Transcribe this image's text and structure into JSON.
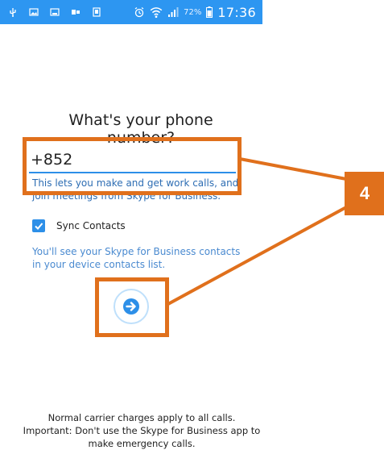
{
  "status_bar": {
    "battery_text": "72%",
    "time": "17:36",
    "left_icons": [
      "usb-icon",
      "image-icon",
      "screen-icon",
      "notification-icon",
      "device-icon"
    ],
    "right_icons": [
      "alarm-icon",
      "wifi-icon",
      "signal-icon",
      "battery-icon"
    ],
    "color": "#2d96f1"
  },
  "screen": {
    "title": "What's your phone number?",
    "phone_input": {
      "value": "+852",
      "placeholder": ""
    },
    "helper_text": "This lets you make and get work calls, and join meetings from Skype for Business.",
    "sync_contacts": {
      "label": "Sync Contacts",
      "checked": true,
      "description": "You'll see your Skype for Business contacts in your device contacts list."
    },
    "next_icon": "arrow-right-icon",
    "footer_lines": [
      "Normal carrier charges apply to all calls.",
      "Important: Don't use the Skype for Business app to",
      "make emergency calls."
    ]
  },
  "annotation": {
    "badge": "4",
    "color": "#e0701c"
  },
  "colors": {
    "accent": "#2d8fe8",
    "text": "#222222"
  }
}
